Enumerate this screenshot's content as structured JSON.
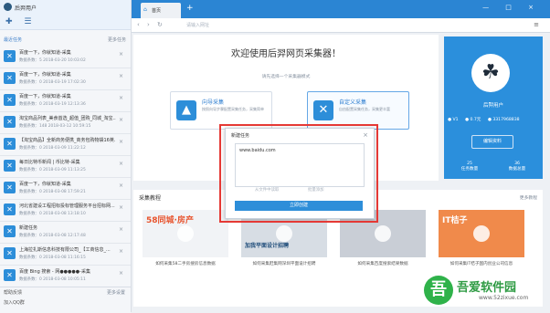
{
  "sidebar": {
    "username": "后羿用户",
    "section_title": "最近任务",
    "more": "更多任务",
    "tasks": [
      {
        "title": "百度一下，你就知道-采集",
        "meta": "数据条数：5   2018-03-20 10:03:02"
      },
      {
        "title": "百度一下，你就知道-采集",
        "meta": "数据条数：0   2018-03-19 17:02:30"
      },
      {
        "title": "百度一下，你就知道-采集",
        "meta": "数据条数：0   2018-03-19 12:13:36"
      },
      {
        "title": "淘宝商品列表_美食首选_超值_团购_同城_淘宝...",
        "meta": "数据条数：148  2018-03-12 10:59:15"
      },
      {
        "title": "【淘宝商品】全新商务便携_商务包购物袋16英...",
        "meta": "数据条数：0   2018-03-09 11:22:12"
      },
      {
        "title": "每日比特币新闻 | 币比特-采集",
        "meta": "数据条数：0   2018-03-09 11:13:25"
      },
      {
        "title": "百度一下，你就知道-采集",
        "meta": "数据条数：0   2018-03-08 17:59:21"
      },
      {
        "title": "河北省建设工程招标投标管理服务平台招标网...",
        "meta": "数据条数：0   2018-03-08 13:18:10"
      },
      {
        "title": "新建任务",
        "meta": "数据条数：0   2018-03-08 12:17:48"
      },
      {
        "title": "上海拉扎斯信息科技有限公司_【工商信息_...",
        "meta": "数据条数：0   2018-03-08 11:16:15"
      },
      {
        "title": "百度 Bing 搜索 - 网●●●●●-采集",
        "meta": "数据条数：0   2018-03-08 10:05:11"
      }
    ],
    "footer_left": "帮助反馈",
    "footer_right": "更多设置",
    "footer_qq": "加入QQ群"
  },
  "tabbar": {
    "tab_label": "首页",
    "plus": "+",
    "controls": "— □ ×"
  },
  "addrbar": {
    "placeholder": "请输入网址",
    "nav": "‹ › ↻"
  },
  "main": {
    "welcome": "欢迎使用后羿网页采集器！",
    "subtitle": "请先选择一个采集器模式",
    "card1": {
      "title": "向导采集",
      "desc": "按照向导步骤配置采集任务，采集简单"
    },
    "card2": {
      "title": "自定义采集",
      "desc": "自由配置采集任务，采集更丰富"
    }
  },
  "profile": {
    "name": "后羿用户",
    "stats": [
      "● V1",
      "● 0.7元",
      "● 3317968838"
    ],
    "edit_btn": "编辑资料",
    "count1_num": "25",
    "count1_label": "任务数量",
    "count2_num": "36",
    "count2_label": "数据总量"
  },
  "tutorials": {
    "title": "采集教程",
    "more": "更多教程",
    "items": [
      {
        "label": "58同城·房产",
        "caption": "如何采集58二手房搜房信息数据"
      },
      {
        "label": "加我平面设计招聘",
        "caption": "如何采集赶集网深圳平面设计招聘"
      },
      {
        "label": "",
        "caption": "如何采集百度搜索结果数据"
      },
      {
        "label": "IT桔子",
        "caption": "如何采集IT桔子国内创业公司信息"
      }
    ]
  },
  "dialog": {
    "title": "新建任务",
    "url": "www.baidu.com",
    "link1": "从文件中读取",
    "link2": "批量添加",
    "button": "立即创建"
  },
  "watermark": {
    "badge": "吾",
    "text": "吾爱软件园",
    "url": "www.52zixue.com",
    "faint": "下载"
  }
}
